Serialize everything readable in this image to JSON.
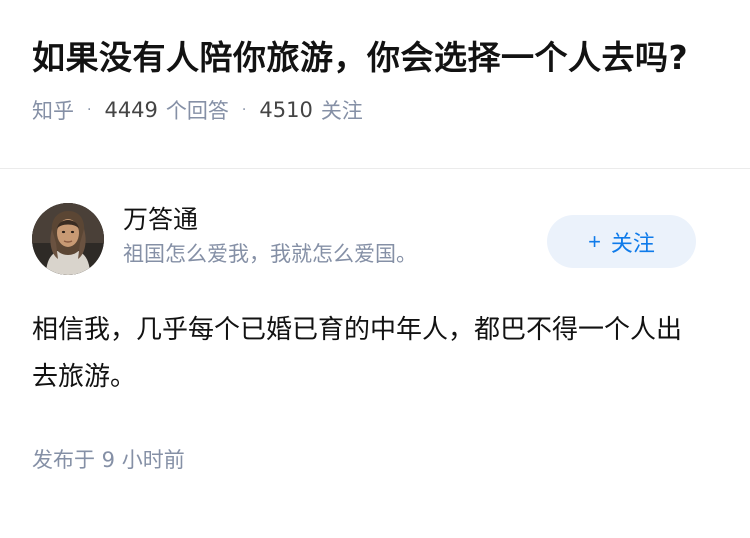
{
  "question": {
    "title": "如果没有人陪你旅游，你会选择一个人去吗?",
    "source": "知乎",
    "separator": "·",
    "answer_count": "4449",
    "answer_label": "个回答",
    "follow_count": "4510",
    "follow_label": "关注"
  },
  "answer": {
    "author": {
      "name": "万答通",
      "bio": "祖国怎么爱我，我就怎么爱国。",
      "avatar_icon": "person-avatar"
    },
    "follow_button": {
      "plus": "+",
      "label": "关注"
    },
    "content": "相信我，几乎每个已婚已育的中年人，都巴不得一个人出去旅游。",
    "time": "发布于  9 小时前"
  },
  "colors": {
    "text_primary": "#121212",
    "text_secondary": "#8590a6",
    "accent": "#0f7bea",
    "button_bg": "#ebf2fb",
    "divider": "#ebebeb"
  }
}
